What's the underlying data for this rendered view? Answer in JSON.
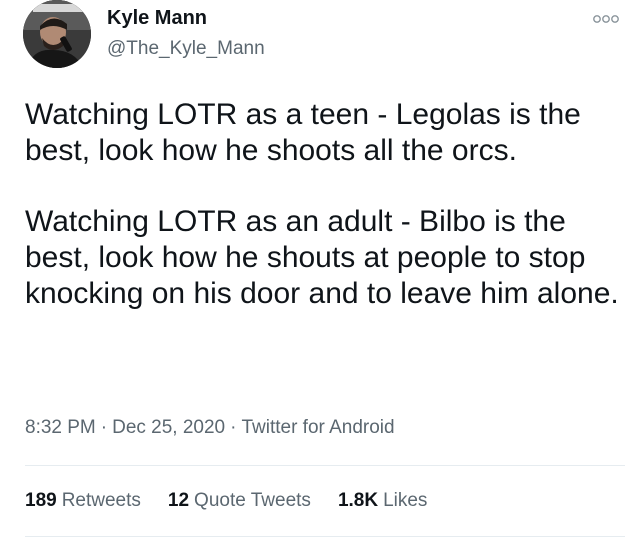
{
  "user": {
    "display_name": "Kyle Mann",
    "handle": "@The_Kyle_Mann",
    "avatar_icon": "user-avatar-photo"
  },
  "tweet": {
    "paragraphs": [
      "Watching LOTR as a teen - Legolas is the best, look how he shoots all the orcs.",
      "Watching LOTR as an adult - Bilbo is the best, look how he shouts at people to stop knocking on his door and to leave him alone."
    ],
    "time": "8:32 PM",
    "date": "Dec 25, 2020",
    "source": "Twitter for Android",
    "separator": "·"
  },
  "stats": {
    "retweets_count": "189",
    "retweets_label": "Retweets",
    "quote_count": "12",
    "quote_label": "Quote Tweets",
    "likes_count": "1.8K",
    "likes_label": "Likes"
  },
  "icons": {
    "more": "more-options-icon"
  },
  "colors": {
    "text_primary": "#0f1419",
    "text_secondary": "#5b6770",
    "divider": "#e6ecf0"
  }
}
